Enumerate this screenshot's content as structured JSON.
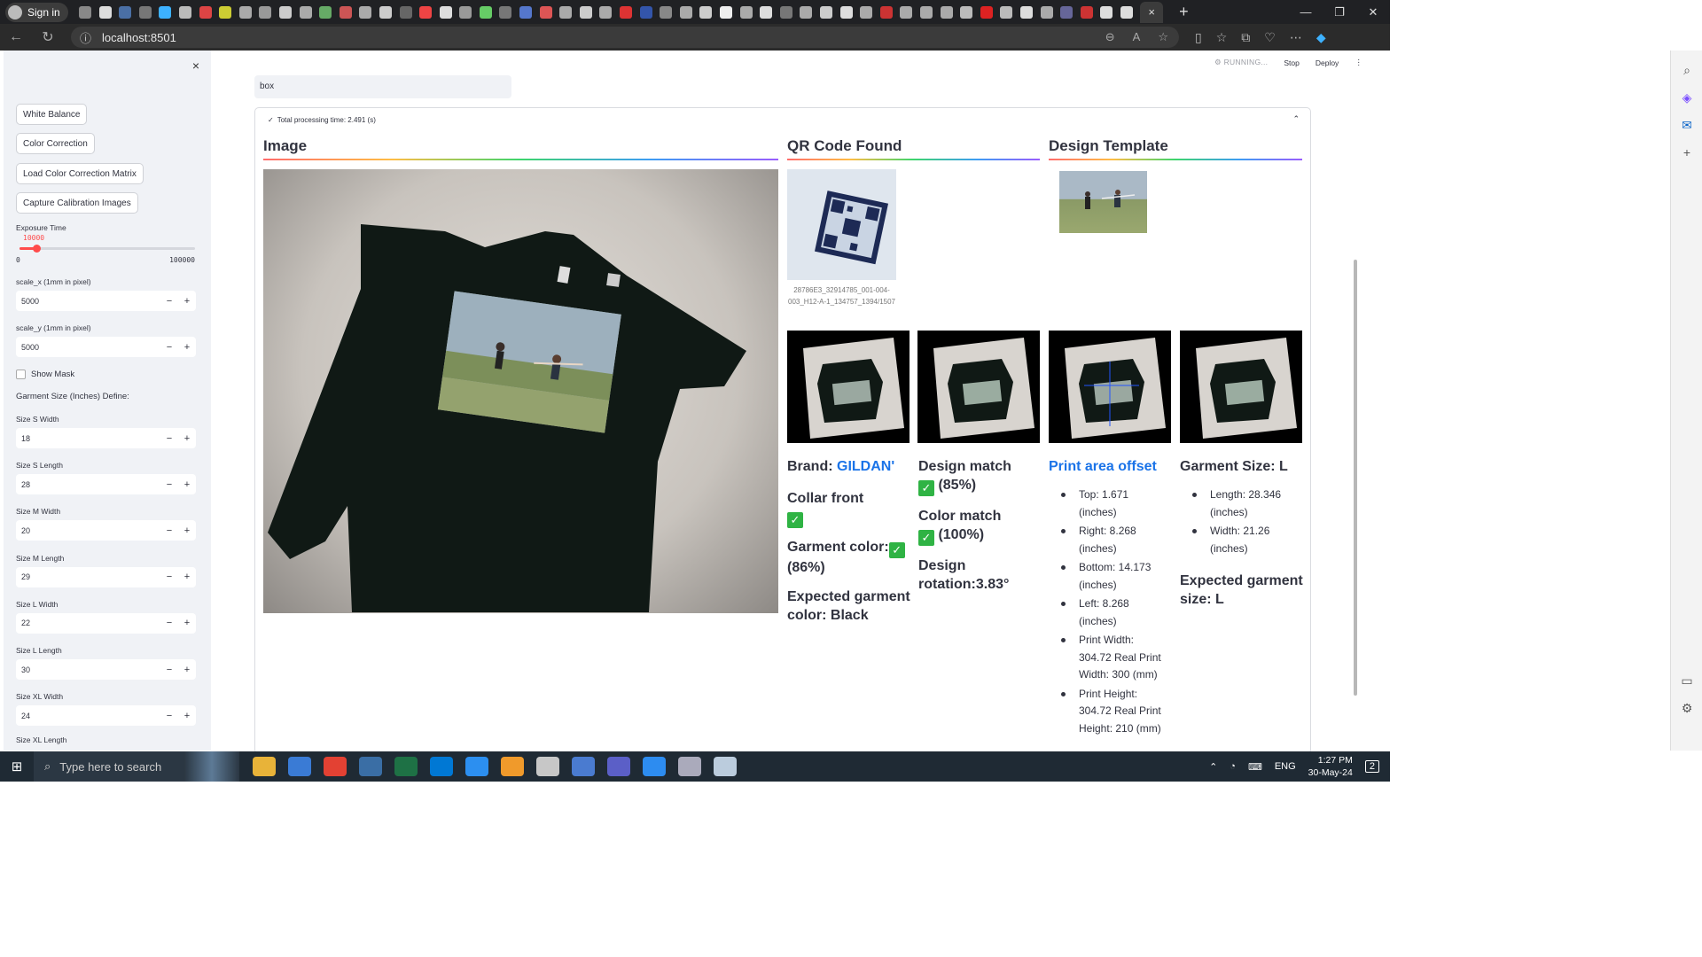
{
  "browser": {
    "signin_label": "Sign in",
    "url": "localhost:8501",
    "tab_close": "×",
    "new_tab": "+"
  },
  "header": {
    "running": "RUNNING...",
    "stop": "Stop",
    "deploy": "Deploy"
  },
  "sidebar": {
    "close": "×",
    "buttons": [
      "White Balance",
      "Color Correction",
      "Load Color Correction Matrix",
      "Capture Calibration Images"
    ],
    "exposure": {
      "label": "Exposure Time",
      "value": 10000,
      "min": 0,
      "max": 100000,
      "value_text": "10000",
      "min_text": "0",
      "max_text": "100000"
    },
    "scale_x": {
      "label": "scale_x (1mm in pixel)",
      "value": "5000"
    },
    "scale_y": {
      "label": "scale_y (1mm in pixel)",
      "value": "5000"
    },
    "show_mask": "Show Mask",
    "garment_define": "Garment Size (Inches) Define:",
    "sizes": [
      {
        "label": "Size S Width",
        "value": "18"
      },
      {
        "label": "Size S Length",
        "value": "28"
      },
      {
        "label": "Size M Width",
        "value": "20"
      },
      {
        "label": "Size M Length",
        "value": "29"
      },
      {
        "label": "Size L Width",
        "value": "22"
      },
      {
        "label": "Size L Length",
        "value": "30"
      },
      {
        "label": "Size XL Width",
        "value": "24"
      }
    ],
    "last_label": "Size XL Length"
  },
  "main": {
    "search_value": "box",
    "processing": "Total processing time: 2.491 (s)",
    "columns": [
      "Image",
      "QR Code Found",
      "Design Template"
    ],
    "qr_caption": "28786E3_32914785_001-004-003_H12-A-1_134757_1394/1507",
    "brand_label": "Brand: ",
    "brand_value": "GILDAN'",
    "collar": "Collar front",
    "garment_color": "Garment color:",
    "garment_color_pct": "(86%)",
    "expected_color": "Expected garment color: Black",
    "design_match": "Design match",
    "design_match_pct": "(85%)",
    "color_match": "Color match",
    "color_match_pct": "(100%)",
    "design_rotation": "Design rotation:3.83°",
    "print_area_title": "Print area offset",
    "print_area": [
      "Top: 1.671 (inches)",
      "Right: 8.268 (inches)",
      "Bottom: 14.173 (inches)",
      "Left: 8.268 (inches)",
      "Print Width: 304.72 Real Print Width: 300 (mm)",
      "Print Height: 304.72 Real Print Height: 210 (mm)"
    ],
    "garment_size_title": "Garment Size: L",
    "garment_size": [
      "Length: 28.346 (inches)",
      "Width: 21.26 (inches)"
    ],
    "expected_size": "Expected garment size: L"
  },
  "taskbar": {
    "search_placeholder": "Type here to search",
    "lang": "ENG",
    "time": "1:27 PM",
    "date": "30-May-24",
    "notif": "2"
  },
  "colors": {
    "accent": "#ff4b4b",
    "link": "#1a73e8",
    "check": "#2fb344",
    "sidebar_bg": "#f0f2f6",
    "shirt": "#101915"
  }
}
